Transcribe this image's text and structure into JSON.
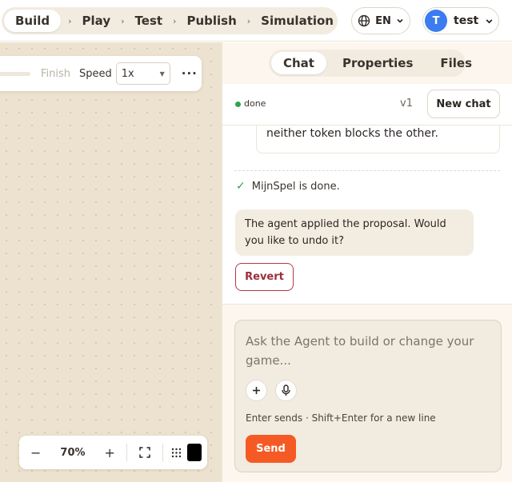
{
  "nav": {
    "steps": [
      {
        "label": "Build",
        "active": true
      },
      {
        "label": "Play"
      },
      {
        "label": "Test"
      },
      {
        "label": "Publish"
      },
      {
        "label": "Simulation"
      }
    ],
    "language": "EN",
    "user": {
      "initial": "T",
      "name": "test",
      "avatar_color": "#3b7cf0"
    }
  },
  "canvas": {
    "toolbar": {
      "finish_label": "Finish",
      "speed_label": "Speed",
      "speed_value": "1x"
    },
    "zoom": {
      "minus": "−",
      "value": "70%",
      "plus": "+",
      "color_swatch": "#000000"
    }
  },
  "panel": {
    "tabs": [
      "Chat",
      "Properties",
      "Files"
    ],
    "active_tab": "Chat",
    "status": "done",
    "version": "v1",
    "new_chat_label": "New chat",
    "messages": {
      "card_text": "neither token blocks the other.",
      "done_text": "MijnSpel is done.",
      "agent_bubble": "The agent applied the proposal. Would you like to undo it?",
      "revert_label": "Revert"
    },
    "composer": {
      "placeholder": "Ask the Agent to build or change your game...",
      "hint": "Enter sends · Shift+Enter for a new line",
      "send_label": "Send"
    }
  },
  "colors": {
    "accent": "#f55a24",
    "revert": "#9c2d3d",
    "status_ok": "#2ea44f"
  }
}
